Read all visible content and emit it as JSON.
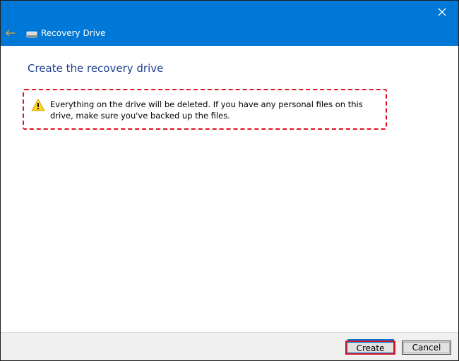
{
  "window": {
    "title": "Recovery Drive"
  },
  "icons": {
    "close": "close-icon",
    "back": "back-arrow-icon",
    "app": "drive-icon",
    "warning": "warning-icon"
  },
  "colors": {
    "titlebar": "#0078d7",
    "page_title": "#1f3f8f",
    "highlight": "#e0141e",
    "back_arrow": "#e8a33c"
  },
  "page": {
    "title": "Create the recovery drive",
    "warning": "Everything on the drive will be deleted. If you have any personal files on this drive, make sure you've backed up the files."
  },
  "footer": {
    "create_label": "Create",
    "cancel_label": "Cancel"
  }
}
